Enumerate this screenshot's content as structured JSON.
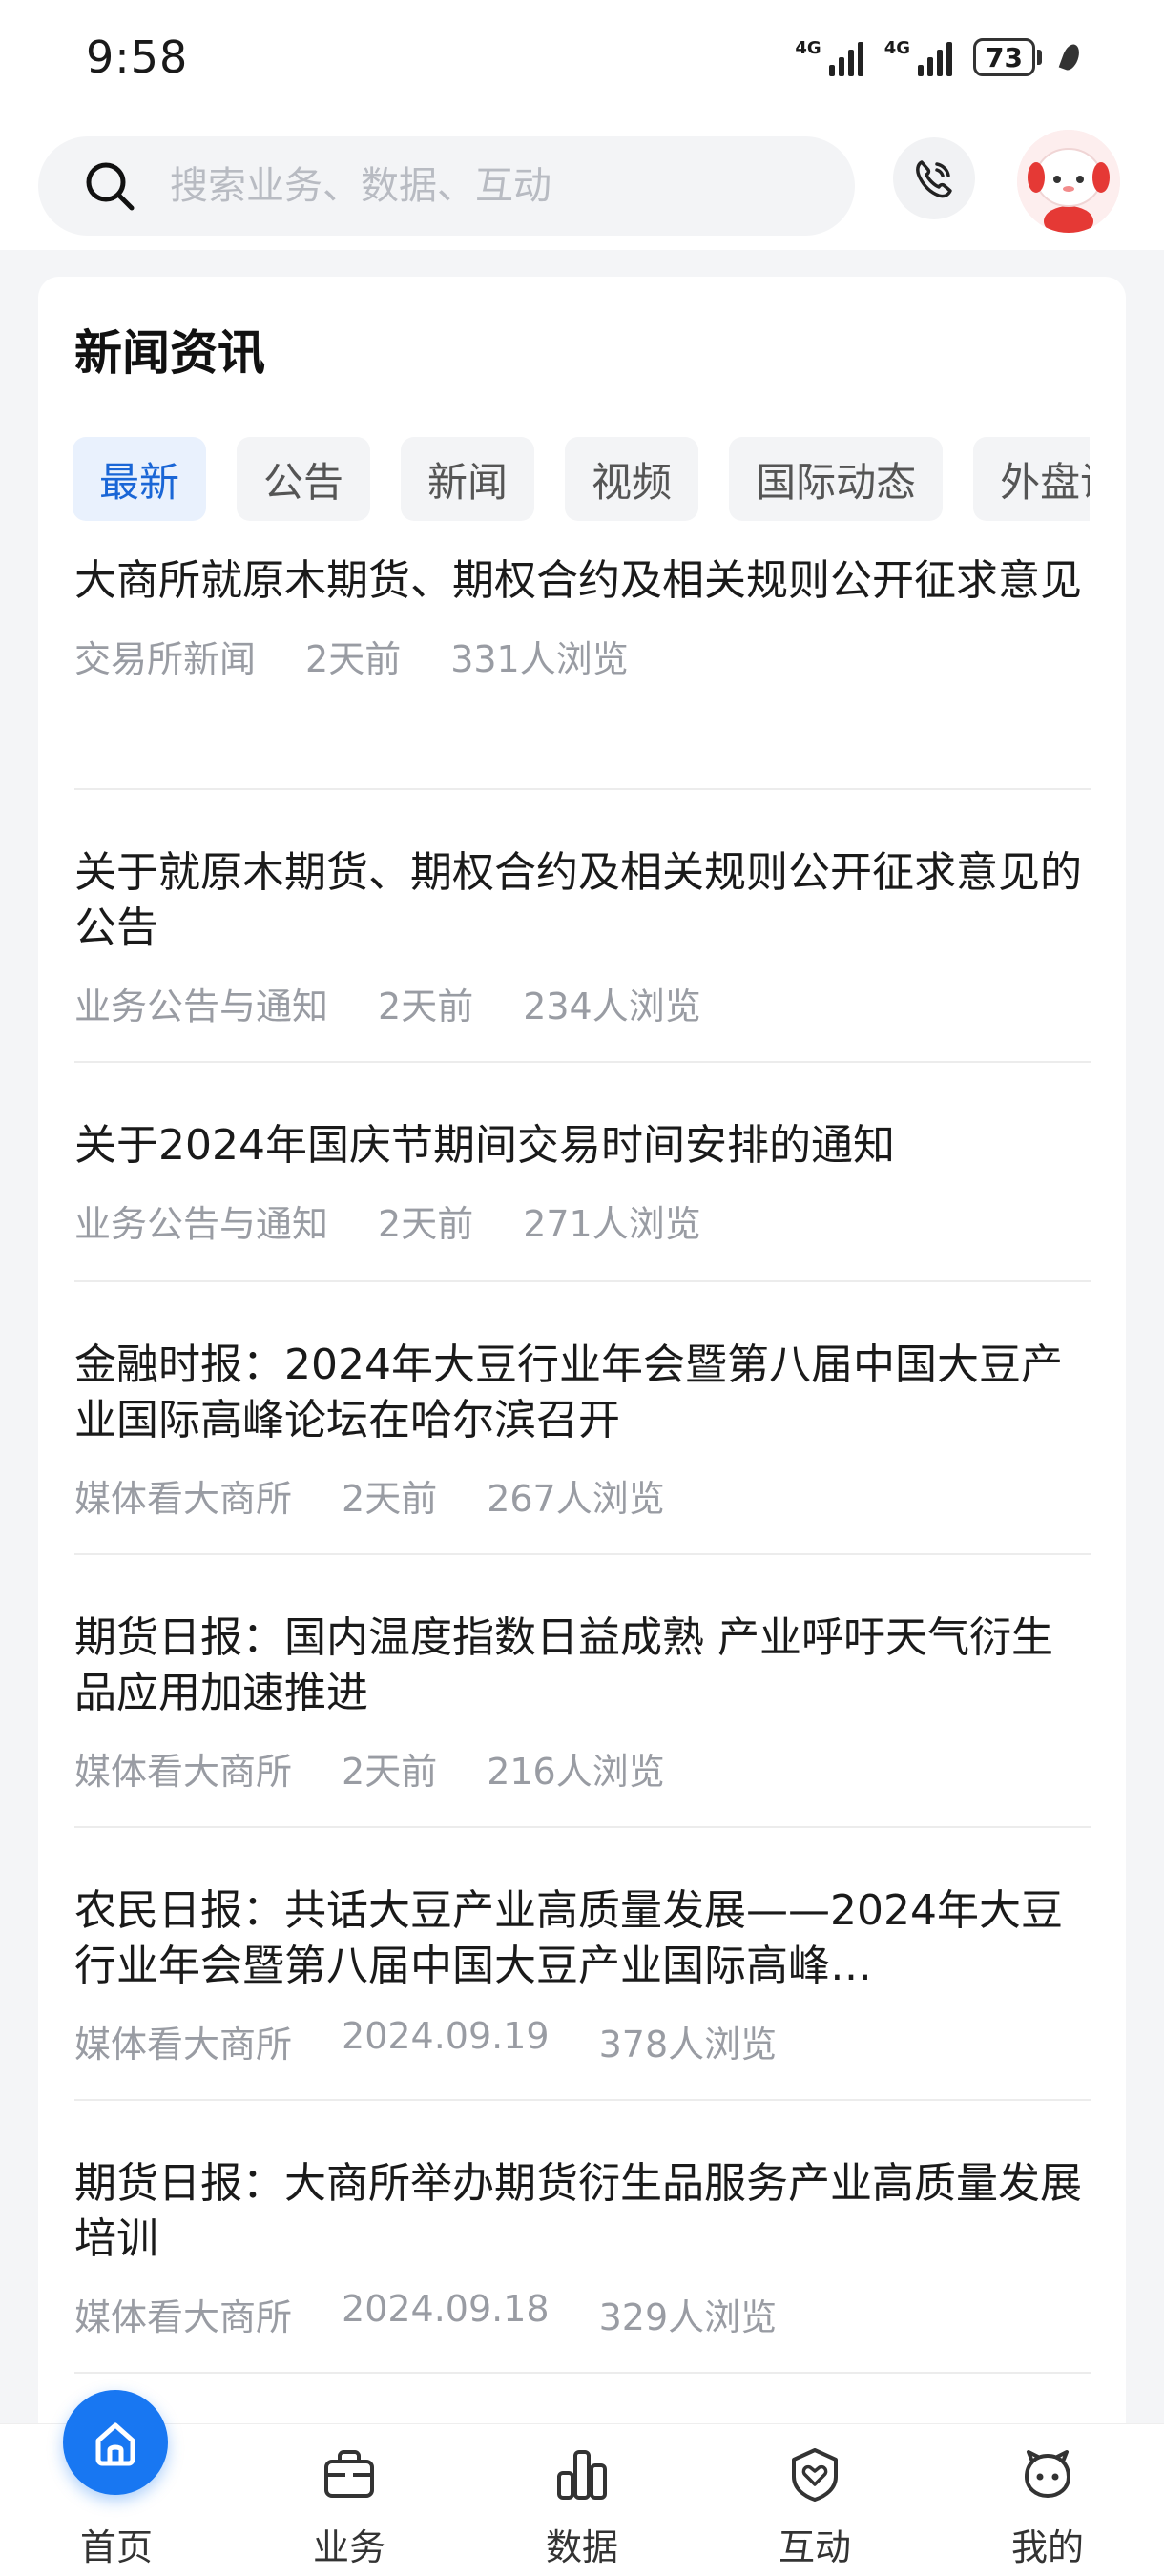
{
  "status_bar": {
    "time": "9:58",
    "network1": "4G",
    "network2": "4G",
    "battery": "73"
  },
  "search": {
    "placeholder": "搜索业务、数据、互动"
  },
  "news_section": {
    "title": "新闻资讯",
    "tabs": [
      {
        "label": "最新",
        "active": true
      },
      {
        "label": "公告",
        "active": false
      },
      {
        "label": "新闻",
        "active": false
      },
      {
        "label": "视频",
        "active": false
      },
      {
        "label": "国际动态",
        "active": false
      },
      {
        "label": "外盘讯",
        "active": false
      }
    ],
    "items": [
      {
        "title": "大商所就原木期货、期权合约及相关规则公开征求意见",
        "source": "交易所新闻",
        "time": "2天前",
        "views": "331人浏览"
      },
      {
        "title": "关于就原木期货、期权合约及相关规则公开征求意见的公告",
        "source": "业务公告与通知",
        "time": "2天前",
        "views": "234人浏览"
      },
      {
        "title": "关于2024年国庆节期间交易时间安排的通知",
        "source": "业务公告与通知",
        "time": "2天前",
        "views": "271人浏览"
      },
      {
        "title": "金融时报：2024年大豆行业年会暨第八届中国大豆产业国际高峰论坛在哈尔滨召开",
        "source": "媒体看大商所",
        "time": "2天前",
        "views": "267人浏览"
      },
      {
        "title": "期货日报：国内温度指数日益成熟 产业呼吁天气衍生品应用加速推进",
        "source": "媒体看大商所",
        "time": "2天前",
        "views": "216人浏览"
      },
      {
        "title": "农民日报：共话大豆产业高质量发展——2024年大豆行业年会暨第八届中国大豆产业国际高峰…",
        "source": "媒体看大商所",
        "time": "2024.09.19",
        "views": "378人浏览"
      },
      {
        "title": "期货日报：大商所举办期货衍生品服务产业高质量发展培训",
        "source": "媒体看大商所",
        "time": "2024.09.18",
        "views": "329人浏览"
      }
    ]
  },
  "bottom_nav": {
    "items": [
      {
        "label": "首页",
        "icon": "home-icon",
        "active": true
      },
      {
        "label": "业务",
        "icon": "briefcase-icon",
        "active": false
      },
      {
        "label": "数据",
        "icon": "bar-chart-icon",
        "active": false
      },
      {
        "label": "互动",
        "icon": "heart-shield-icon",
        "active": false
      },
      {
        "label": "我的",
        "icon": "profile-face-icon",
        "active": false
      }
    ]
  },
  "colors": {
    "accent": "#1877f2",
    "active_tab_text": "#1a66d6",
    "active_tab_bg": "#e9f1fd",
    "meta_text": "#999ca3"
  }
}
